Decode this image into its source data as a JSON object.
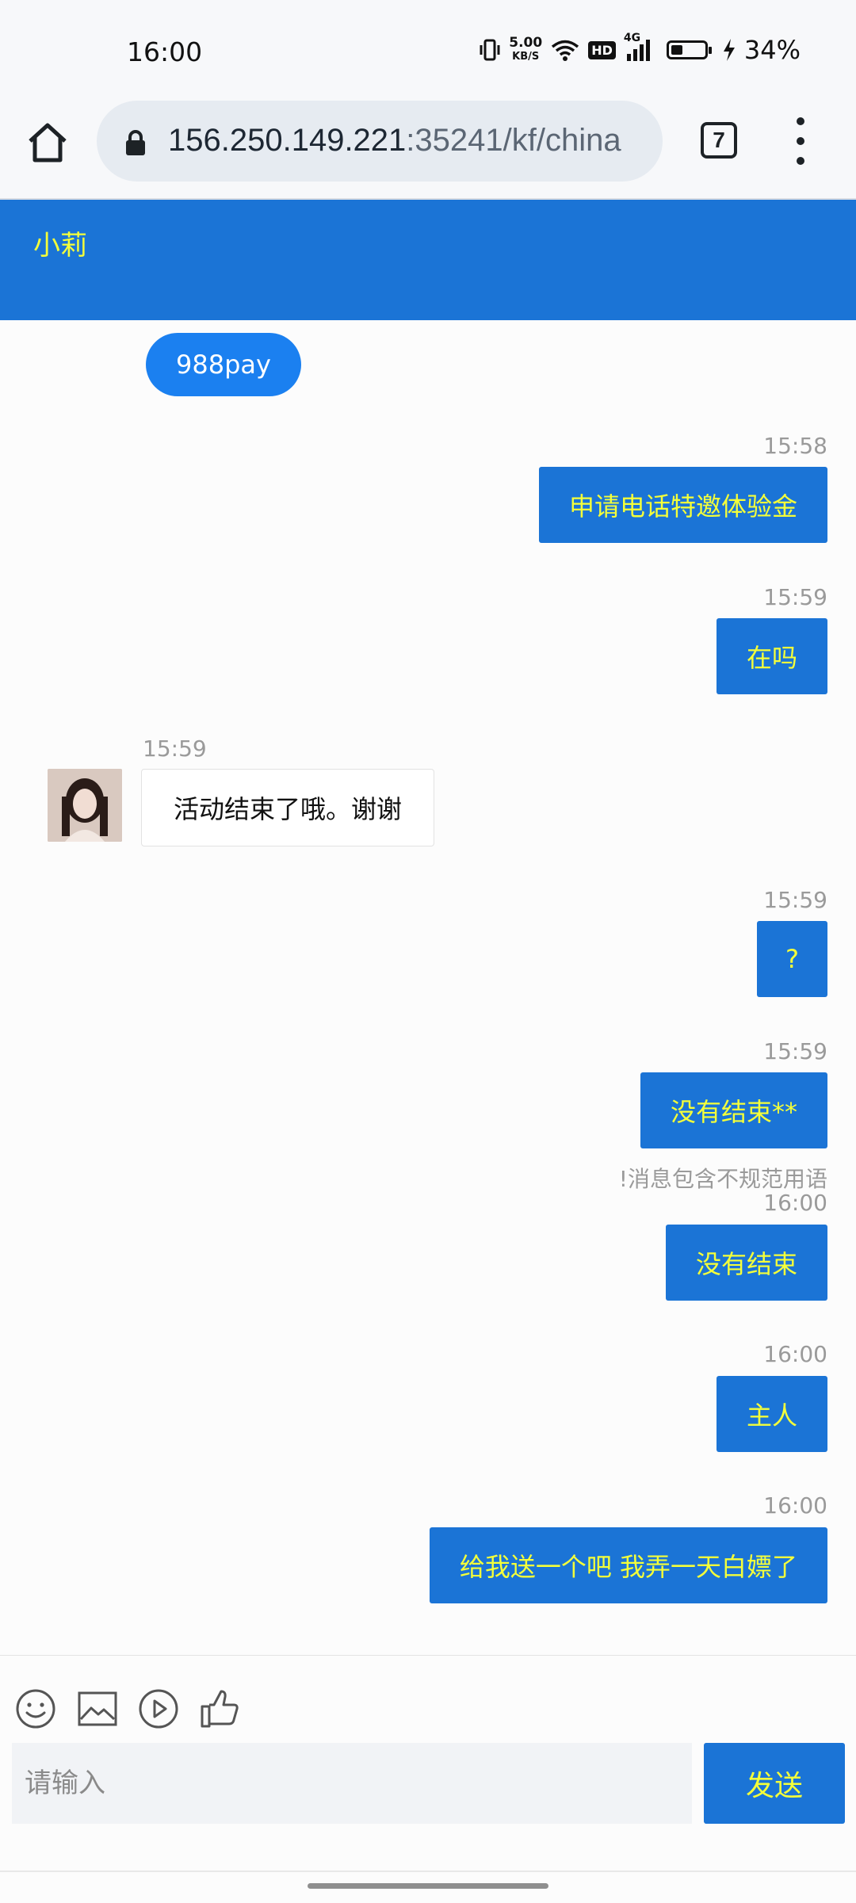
{
  "status_bar": {
    "time": "16:00",
    "net_speed_value": "5.00",
    "net_speed_unit": "KB/S",
    "hd_label": "HD",
    "signal_label": "4G",
    "battery_percent": "34%",
    "battery_level": 0.34
  },
  "browser": {
    "url_host": "156.250.149.221",
    "url_rest": ":35241/kf/china",
    "tab_count": "7"
  },
  "chat": {
    "agent_name": "小莉",
    "quick_reply": "988pay",
    "messages": [
      {
        "time": "15:58",
        "text": "申请电话特邀体验金"
      },
      {
        "time": "15:59",
        "text": "在吗"
      },
      {
        "time": "15:59",
        "text": "活动结束了哦。谢谢"
      },
      {
        "time": "15:59",
        "text": "?"
      },
      {
        "time": "15:59",
        "text": "没有结束**"
      },
      {
        "warning": "!消息包含不规范用语",
        "time": "16:00",
        "text": "没有结束"
      },
      {
        "time": "16:00",
        "text": "主人"
      },
      {
        "time": "16:00",
        "text": "给我送一个吧 我弄一天白嫖了"
      }
    ]
  },
  "composer": {
    "placeholder": "请输入",
    "send_label": "发送",
    "tools": [
      "emoji-icon",
      "image-icon",
      "video-play-icon",
      "thumbs-up-icon"
    ]
  },
  "colors": {
    "accent": "#1b74d6",
    "accent_text": "#f4ff3a",
    "pill": "#1b80f0"
  }
}
